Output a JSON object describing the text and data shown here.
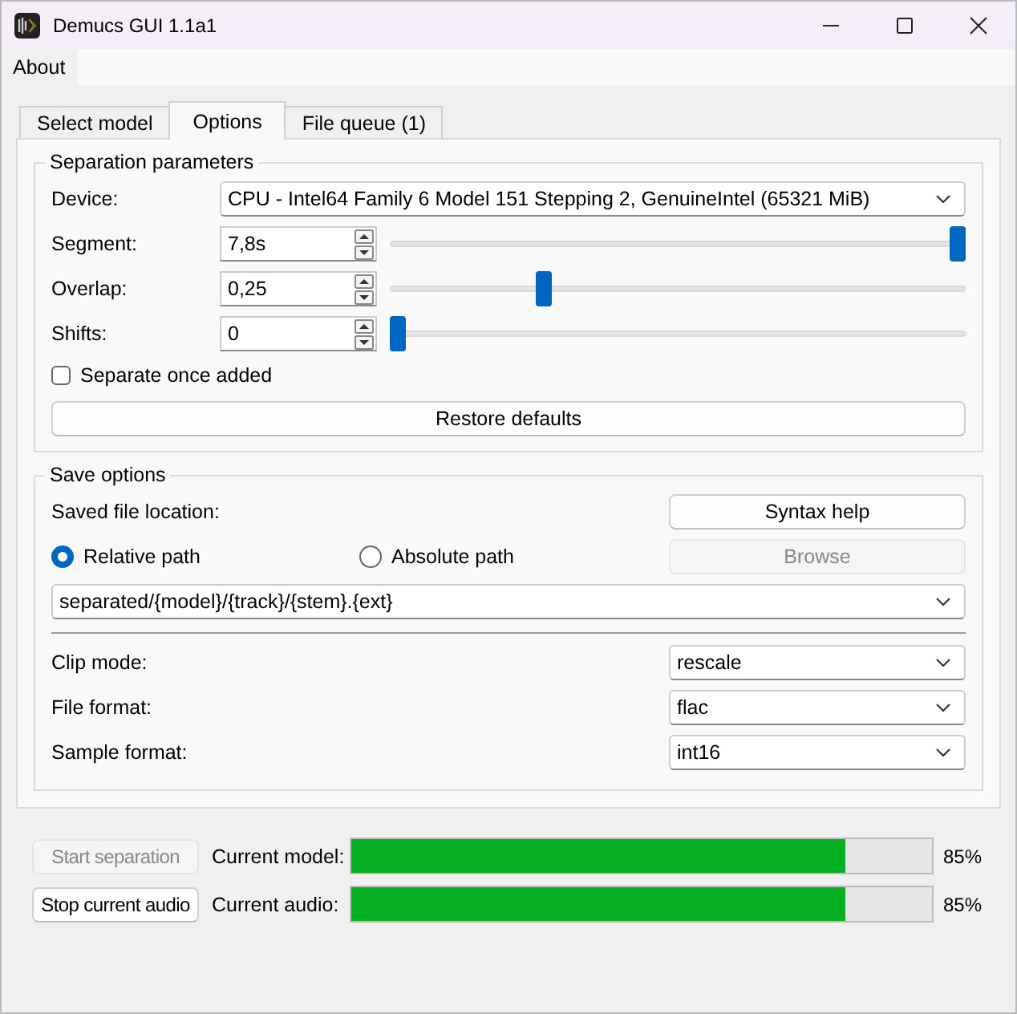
{
  "window": {
    "title": "Demucs GUI 1.1a1"
  },
  "menu": [
    {
      "label": "About"
    }
  ],
  "tabs": [
    {
      "label": "Select model",
      "selected": false
    },
    {
      "label": "Options",
      "selected": true
    },
    {
      "label": "File queue (1)",
      "selected": false
    }
  ],
  "separation_parameters": {
    "title": "Separation parameters",
    "device": {
      "label": "Device:",
      "value": "CPU - Intel64 Family 6 Model 151 Stepping 2, GenuineIntel (65321 MiB)"
    },
    "params": [
      {
        "label": "Segment:",
        "value": "7,8s",
        "level": 1
      },
      {
        "label": "Overlap:",
        "value": "0,25",
        "level": 0.26
      },
      {
        "label": "Shifts:",
        "value": "0",
        "level": 0
      }
    ],
    "separate_once_added": {
      "label": "Separate once added",
      "checked": false
    },
    "restore_button": "Restore defaults"
  },
  "save_options": {
    "title": "Save options",
    "location_label": "Saved file location:",
    "syntax_help_button": "Syntax help",
    "path_options": [
      {
        "label": "Relative path",
        "selected": true
      },
      {
        "label": "Absolute path",
        "selected": false
      }
    ],
    "browse_button": {
      "label": "Browse",
      "disabled": true
    },
    "path_value": "separated/{model}/{track}/{stem}.{ext}",
    "selects": [
      {
        "label": "Clip mode:",
        "value": "rescale"
      },
      {
        "label": "File format:",
        "value": "flac"
      },
      {
        "label": "Sample format:",
        "value": "int16"
      }
    ]
  },
  "progress": [
    {
      "button": {
        "label": "Start separation",
        "disabled": true
      },
      "label": "Current model:",
      "level": 0.85,
      "reading": "85%"
    },
    {
      "button": {
        "label": "Stop current audio",
        "disabled": false
      },
      "label": "Current audio:",
      "level": 0.85,
      "reading": "85%"
    }
  ]
}
